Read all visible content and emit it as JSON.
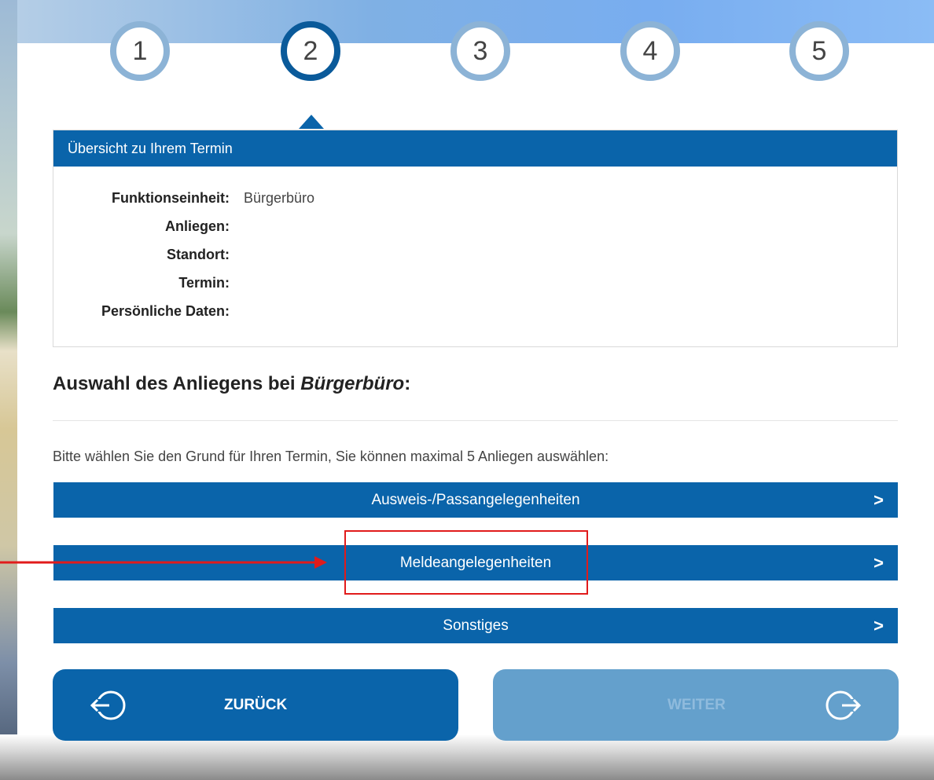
{
  "steps": [
    "1",
    "2",
    "3",
    "4",
    "5"
  ],
  "active_step": 2,
  "overview": {
    "title": "Übersicht zu Ihrem Termin",
    "rows": [
      {
        "label": "Funktionseinheit:",
        "value": "Bürgerbüro"
      },
      {
        "label": "Anliegen:",
        "value": ""
      },
      {
        "label": "Standort:",
        "value": ""
      },
      {
        "label": "Termin:",
        "value": ""
      },
      {
        "label": "Persönliche Daten:",
        "value": ""
      }
    ]
  },
  "section": {
    "title_prefix": "Auswahl des Anliegens bei ",
    "title_emphasis": "Bürgerbüro",
    "title_suffix": ":"
  },
  "hint": "Bitte wählen Sie den Grund für Ihren Termin, Sie können maximal 5 Anliegen auswählen:",
  "categories": [
    {
      "label": "Ausweis-/Passangelegenheiten",
      "chevron": ">"
    },
    {
      "label": "Meldeangelegenheiten",
      "chevron": ">"
    },
    {
      "label": "Sonstiges",
      "chevron": ">"
    }
  ],
  "nav": {
    "back_label": "ZURÜCK",
    "back_icon": "exit-left-icon",
    "next_label": "WEITER",
    "next_icon": "exit-right-icon"
  },
  "colors": {
    "primary": "#0a64aa",
    "disabled": "#64a0cc",
    "step_inactive": "#8cb3d6",
    "step_active": "#0a5a9a",
    "annotation": "#e11b1b"
  }
}
